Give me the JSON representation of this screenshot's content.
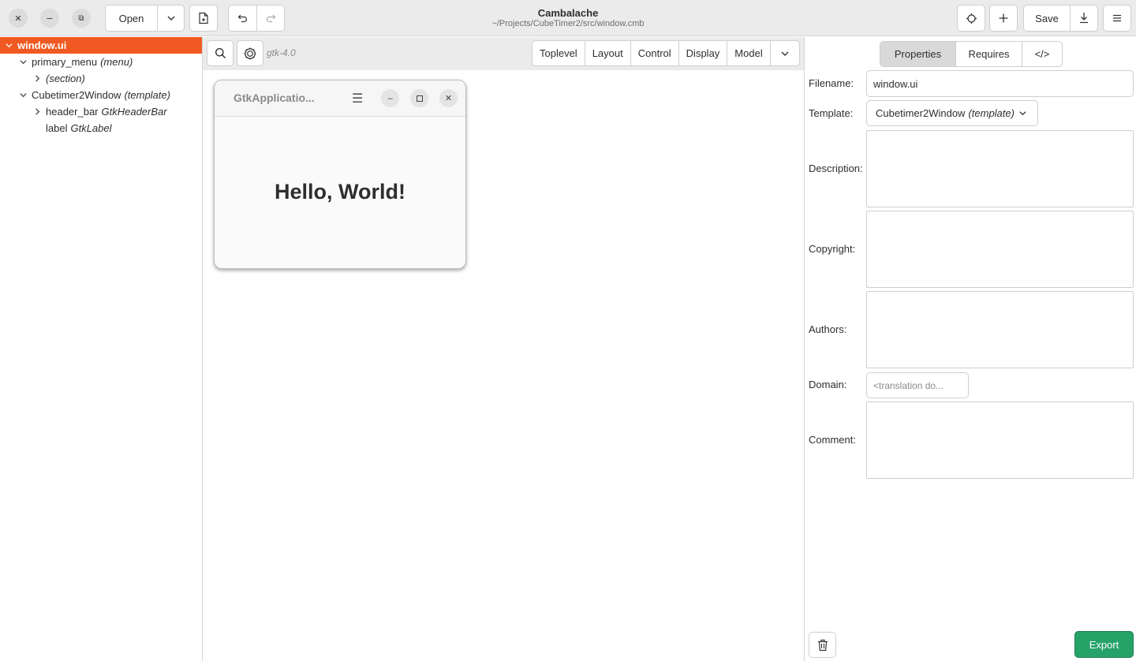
{
  "window": {
    "title": "Cambalache",
    "subtitle": "~/Projects/CubeTimer2/src/window.cmb"
  },
  "toolbar": {
    "close_icon": "close-icon",
    "minimize_icon": "minimize-icon",
    "restore_icon": "restore-icon",
    "open_label": "Open",
    "open_dropdown_icon": "chevron-down-icon",
    "new_file_icon": "new-file-icon",
    "undo_icon": "undo-icon",
    "redo_icon": "redo-icon",
    "target_icon": "target-icon",
    "add_icon": "plus-icon",
    "save_label": "Save",
    "save_as_icon": "download-icon",
    "menu_icon": "hamburger-icon"
  },
  "tree": {
    "items": [
      {
        "name": "window.ui",
        "type": "",
        "expander": "open",
        "selected": true
      },
      {
        "name": "primary_menu",
        "type": "(menu)",
        "expander": "open",
        "selected": false
      },
      {
        "name": "",
        "type": "(section)",
        "expander": "closed",
        "selected": false
      },
      {
        "name": "Cubetimer2Window",
        "type": "(template)",
        "expander": "open",
        "selected": false
      },
      {
        "name": "header_bar",
        "type": "GtkHeaderBar",
        "expander": "closed",
        "selected": false
      },
      {
        "name": "label",
        "type": "GtkLabel",
        "expander": "none",
        "selected": false
      }
    ]
  },
  "workspace": {
    "search_icon": "search-icon",
    "gtk_icon": "gtk-logo-icon",
    "gtk_version": "gtk-4.0",
    "categories": [
      "Toplevel",
      "Layout",
      "Control",
      "Display",
      "Model"
    ],
    "more_icon": "chevron-down-icon",
    "preview": {
      "title": "GtkApplicatio...",
      "label": "Hello, World!"
    }
  },
  "properties": {
    "tabs": [
      "Properties",
      "Requires",
      "</>"
    ],
    "active_tab": "Properties",
    "filename_label": "Filename:",
    "filename_value": "window.ui",
    "template_label": "Template:",
    "template_value": "Cubetimer2Window",
    "template_suffix": "(template)",
    "description_label": "Description:",
    "copyright_label": "Copyright:",
    "authors_label": "Authors:",
    "domain_label": "Domain:",
    "domain_placeholder": "<translation do...",
    "comment_label": "Comment:",
    "delete_icon": "trash-icon",
    "export_label": "Export"
  },
  "colors": {
    "accent_selection": "#f05a22",
    "export_button": "#26a269",
    "headerbar_bg": "#ebebeb"
  }
}
